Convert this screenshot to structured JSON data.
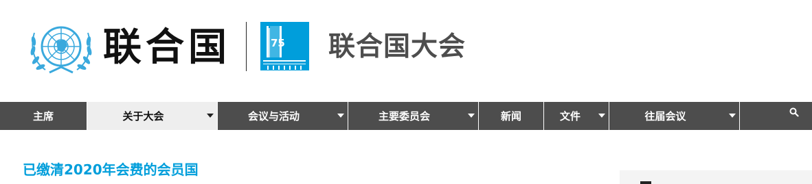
{
  "header": {
    "org_name": "联合国",
    "site_title": "联合国大会",
    "ga_logo_text": "75"
  },
  "nav": {
    "items": [
      {
        "label": "主席",
        "has_dropdown": false,
        "active": false
      },
      {
        "label": "关于大会",
        "has_dropdown": true,
        "active": true
      },
      {
        "label": "会议与活动",
        "has_dropdown": true,
        "active": false
      },
      {
        "label": "主要委员会",
        "has_dropdown": true,
        "active": false
      },
      {
        "label": "新闻",
        "has_dropdown": false,
        "active": false
      },
      {
        "label": "文件",
        "has_dropdown": true,
        "active": false
      },
      {
        "label": "往届会议",
        "has_dropdown": true,
        "active": false
      }
    ],
    "search_icon": "search-icon"
  },
  "main": {
    "heading": "已缴清2020年会费的会员国"
  },
  "colors": {
    "accent": "#009edb",
    "nav_bg": "#4d4d4d",
    "nav_active_bg": "#eeeeee",
    "title_gray": "#4d4d4d"
  }
}
